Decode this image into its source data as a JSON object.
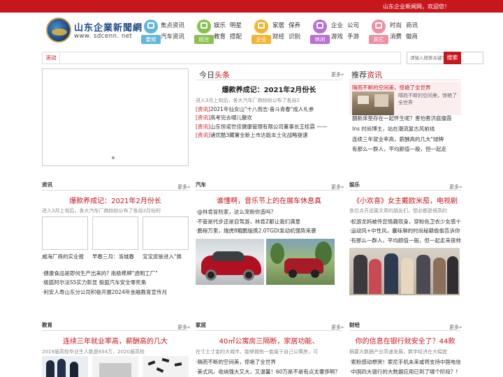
{
  "topbar": {
    "welcome": "山东企业新闻网，欢迎您！"
  },
  "logo": {
    "title": "山东企業新聞網",
    "url": "www. sdcenn. net"
  },
  "categories": [
    {
      "label": "要闻",
      "color": "#63b6d8",
      "links": [
        "焦点资讯",
        "汽车资讯"
      ]
    },
    {
      "label": "综合",
      "color": "#8cc152",
      "links": [
        "娱乐",
        "明星",
        "教育",
        "搭配"
      ]
    },
    {
      "label": "企业",
      "color": "#f2b533",
      "links": [
        "家居",
        "保养",
        "财经",
        "识别"
      ]
    },
    {
      "label": "休闲",
      "color": "#b86fd6",
      "links": [
        "企业",
        "公司",
        "游戏",
        "手游"
      ]
    },
    {
      "label": "其它",
      "color": "#ef8fa3",
      "links": [
        "时尚",
        "商讯",
        "消费",
        "徽商"
      ]
    }
  ],
  "search": {
    "roll_label": "滚动",
    "placeholder": "请输入搜索关键字",
    "button": "搜索"
  },
  "today": {
    "title_a": "今日",
    "title_b": "头条",
    "more": "更多»",
    "headline": "爆款养成记：2021年2月份长",
    "summary": "进入3月上旬后，各大汽车厂商纷纷公布了各自2",
    "items": [
      {
        "tag": "[资讯]",
        "text": "2021年仙女山\"十八而志·奋斗青春\"成人礼参"
      },
      {
        "tag": "[资讯]",
        "text": "高考完去哪儿撒欢"
      },
      {
        "tag": "[资讯]",
        "text": "山东恒诺世佳健康管理有限公司董事长王桂霖 ——"
      },
      {
        "tag": "[资讯]",
        "text": "诸优酷3藏薯全新上市达能本土化战略提速"
      }
    ]
  },
  "recommend": {
    "title_a": "推荐",
    "title_b": "资讯",
    "top_title": "隔而不断的空间美，惊艳了全世界",
    "top_desc": "隔而不断的空间美，惊艳了全世界",
    "items": [
      "翻新床垫存在一起怀生呢？害怕害济庭擅霞",
      "Ins 时尚博主，站在潮流复古风前线",
      "连续三年就业率高，薪酬高的几大\"绿牌",
      "有那么一群人，平均颜值一般，但一起走"
    ]
  },
  "news": {
    "title": "资讯",
    "more": "更多»",
    "headline": "爆款养成记：2021年2月份长",
    "summary": "进入3月上旬后，各大汽车厂商纷纷公布了各自2月份的",
    "captions": [
      "威海厂商的实业报",
      "早春三月：洛城春",
      "宝宝皮肤进入\"换"
    ],
    "items": [
      "·健康食品是即何生产出来的? 南极榫牌\"透明工厂\"",
      "·极狐阿尔法S5实力彰显 极狐汽车安全零死角",
      "·利安人寿山东分公司积极开展2024年金融教育宣传月"
    ]
  },
  "auto": {
    "title": "汽车",
    "more": "更多»",
    "headline": "谁懂啊，音乐节上的在展车休息真",
    "items": [
      "·@林肯冒险家，这么宠粉你造吗？",
      "·不管是代步还是自驾游，林肯Z都让我们满意",
      "·鹏程万里，瑞虎8鲲鹏版携2.0TGDI发动机强势来袭"
    ]
  },
  "ent": {
    "title": "娱乐",
    "more": "更多»",
    "headline": "《小欢喜》女主戴欧米茄，电视剧",
    "summary": "各位点开这篇文章的朋友们，想必都是很高的",
    "items": [
      "·权游龙妈被传您情趣现身，穿粉色卫衣少女感十",
      "·运动风+中性风，囊咏琳的时尚秘籍偷偷告诉你",
      "·有那么一群人，平均颜值一般，但一起走来很帅。"
    ]
  },
  "edu": {
    "title": "教育",
    "more": "更多»",
    "headline": "连续三年就业率高，薪酬高的几大",
    "summary": "2019届高校毕业生人数是834万，2020届高校"
  },
  "home": {
    "title": "家居",
    "more": "更多»",
    "headline": "40㎡公寓房三隔断，家居功能、",
    "summary": "在寸土寸金的大城市，能够拥有一套属于自己公寓房，可",
    "items": [
      "·隔而不断的空间美，惊艳了全世界",
      "·美式风，收纳强大又大，又温馨！60万是不是有点太奢侈啊？"
    ]
  },
  "finance": {
    "title": "财经",
    "more": "更多»",
    "headline": "你的信息在银行就安全了？44款",
    "summary": "摘要大数据产业高速发展，数字经济在大幅提",
    "items": [
      "·索粉感动想哭！索尼手机未来或将支持中国电信!",
      "·中国四大银行的大数据应用已到了哪个阶段？!"
    ]
  }
}
